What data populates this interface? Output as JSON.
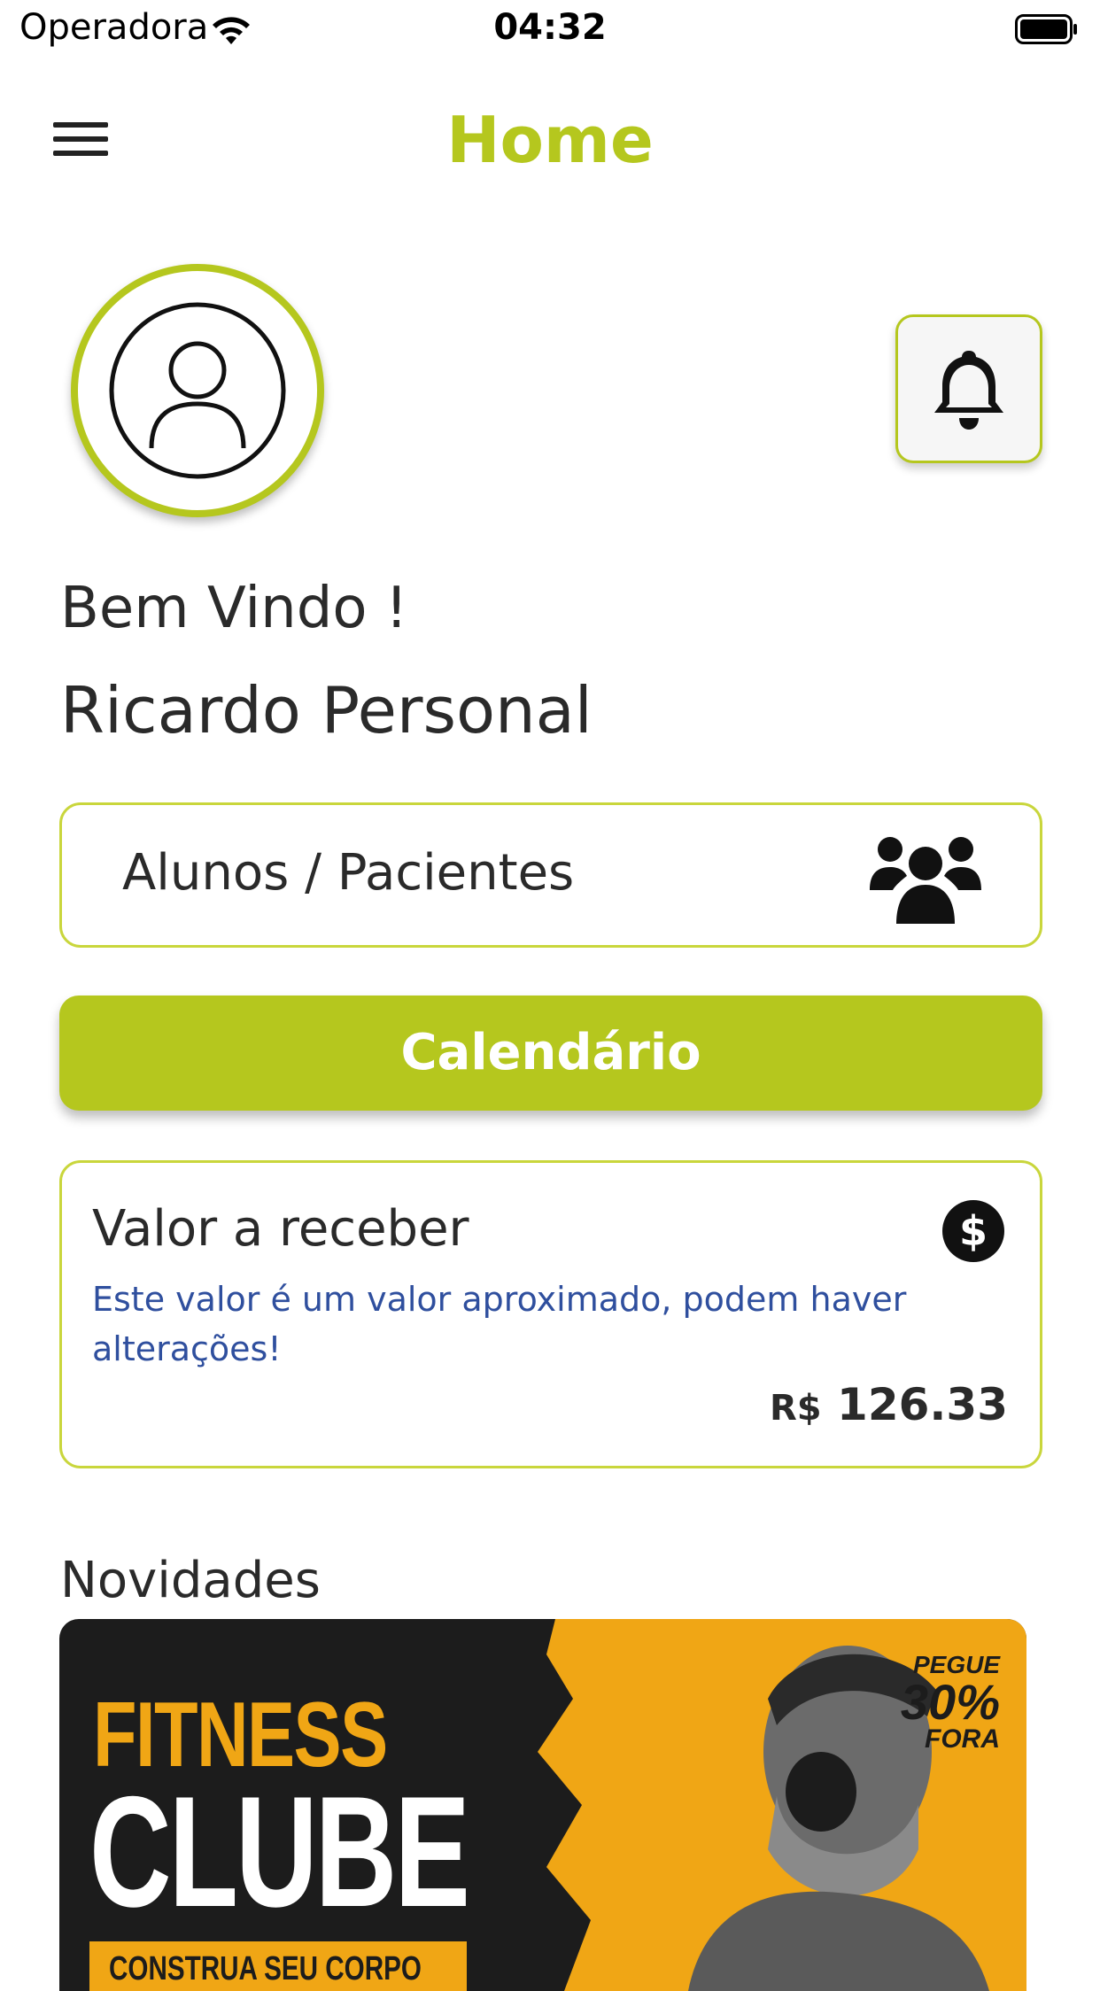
{
  "status_bar": {
    "carrier": "Operadora",
    "time": "04:32"
  },
  "header": {
    "title": "Home",
    "menu_icon": "hamburger-menu-icon"
  },
  "profile": {
    "avatar_icon": "user-avatar-icon",
    "bell_icon": "bell-icon",
    "welcome": "Bem Vindo !",
    "name": "Ricardo Personal"
  },
  "alunos": {
    "label": "Alunos / Pacientes",
    "icon": "users-group-icon"
  },
  "calendar": {
    "label": "Calendário"
  },
  "valor": {
    "title": "Valor a receber",
    "note": "Este valor é um valor aproximado, podem haver alterações!",
    "currency": "R$",
    "amount": "126.33",
    "icon": "dollar-circle-icon"
  },
  "news": {
    "title": "Novidades",
    "banner": {
      "headline1": "FITNESS",
      "headline2": "CLUBE",
      "tagline": "CONSTRUA SEU CORPO",
      "promo_line1": "PEGUE",
      "promo_line2": "30%",
      "promo_line3": "FORA"
    }
  },
  "colors": {
    "accent": "#b5c71e",
    "note_text": "#2f4f9e",
    "banner_orange": "#f0a615"
  }
}
